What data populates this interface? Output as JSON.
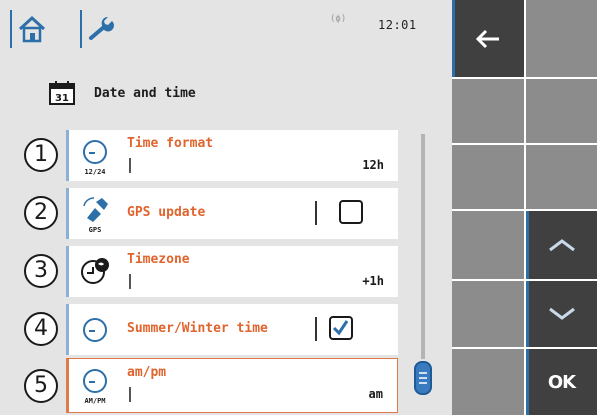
{
  "topbar": {
    "home_icon": "home-icon",
    "settings_icon": "wrench-icon",
    "signal_text": "(ϕ)",
    "clock": "12:01"
  },
  "page": {
    "title": "Date and time",
    "icon": "calendar-icon",
    "icon_text": "31"
  },
  "rows": [
    {
      "number": "1",
      "label": "Time format",
      "value": "12h",
      "icon": "clock-icon",
      "icon_caption": "12/24",
      "type": "value"
    },
    {
      "number": "2",
      "label": "GPS update",
      "checked": false,
      "icon": "gps-satellite-icon",
      "icon_caption": "GPS",
      "type": "checkbox"
    },
    {
      "number": "3",
      "label": "Timezone",
      "value": "+1h",
      "icon": "globe-clock-icon",
      "icon_caption": "",
      "type": "value"
    },
    {
      "number": "4",
      "label": "Summer/Winter time",
      "checked": true,
      "icon": "clock-icon",
      "icon_caption": "",
      "type": "checkbox"
    },
    {
      "number": "5",
      "label": "am/pm",
      "value": "am",
      "icon": "clock-icon",
      "icon_caption": "AM/PM",
      "type": "value",
      "active": true
    }
  ],
  "softkeys": {
    "back_icon": "back-arrow-icon",
    "up_icon": "chevron-up-icon",
    "down_icon": "chevron-down-icon",
    "ok_label": "OK"
  },
  "colors": {
    "accent": "#e0642e",
    "blue": "#2d6fa8",
    "panel": "#e4e4e4",
    "key_dark": "#404040",
    "key_grey": "#8c8c8c"
  }
}
